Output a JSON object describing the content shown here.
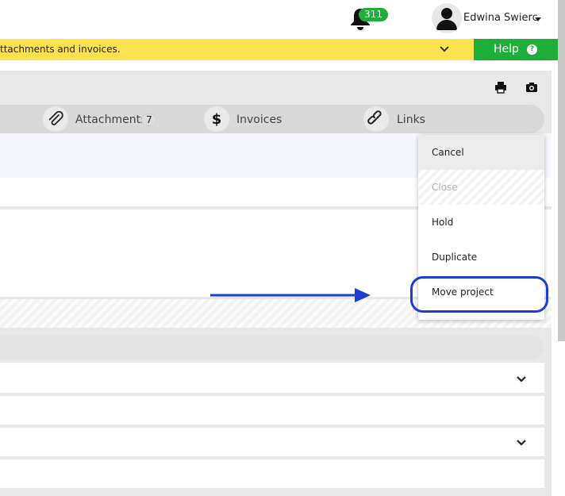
{
  "header": {
    "notifications": {
      "count": "311",
      "icon": "bell-icon"
    },
    "user": {
      "name": "Edwina Swierc",
      "avatar_icon": "user-avatar-icon"
    }
  },
  "notice": {
    "text": "ttachments and invoices.",
    "help_label": "Help",
    "help_icon_glyph": "?",
    "bar_color": "#fee24f",
    "help_color": "#1fae3a"
  },
  "toolbar": {
    "print_icon": "print-icon",
    "camera_icon": "camera-icon"
  },
  "tabs": [
    {
      "label": "Attachments",
      "count": "7",
      "icon": "paperclip-icon"
    },
    {
      "label": "Invoices",
      "icon": "dollar-icon"
    },
    {
      "label": "Links",
      "icon": "link-icon"
    }
  ],
  "menu": {
    "items": [
      {
        "label": "Cancel",
        "state": "hover"
      },
      {
        "label": "Close",
        "state": "disabled"
      },
      {
        "label": "Hold",
        "state": "normal"
      },
      {
        "label": "Duplicate",
        "state": "normal"
      },
      {
        "label": "Move project",
        "state": "highlighted"
      }
    ],
    "highlight_color": "#1c3fcf"
  }
}
